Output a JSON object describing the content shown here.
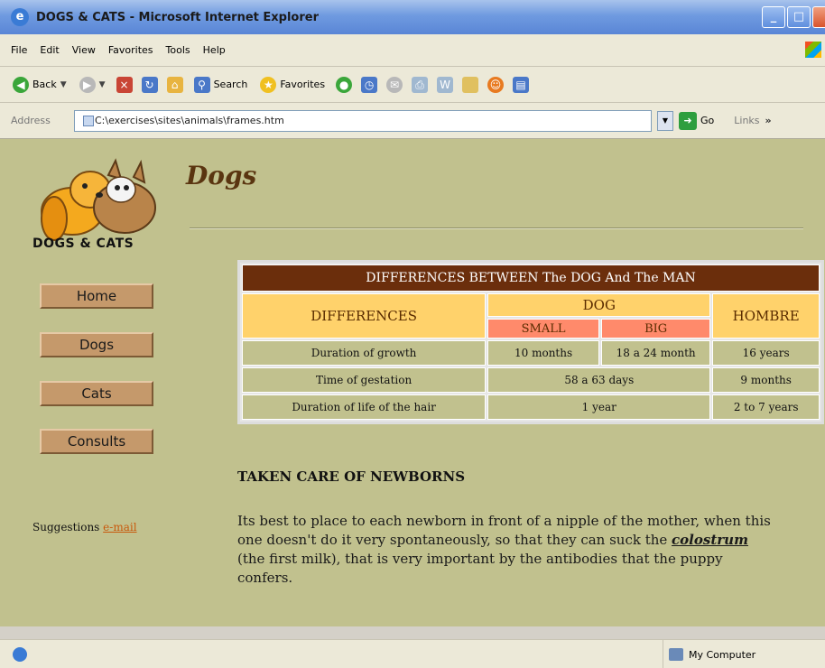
{
  "window": {
    "title": "DOGS & CATS - Microsoft Internet Explorer",
    "min_label": "_",
    "max_label": "□"
  },
  "menu": {
    "items": [
      "File",
      "Edit",
      "View",
      "Favorites",
      "Tools",
      "Help"
    ]
  },
  "toolbar": {
    "back_label": "Back",
    "search_label": "Search",
    "favorites_label": "Favorites"
  },
  "address": {
    "label": "Address",
    "value": "C:\\exercises\\sites\\animals\\frames.htm",
    "go_label": "Go",
    "links_label": "Links"
  },
  "sidebar": {
    "logo_text": "DOGS & CATS",
    "nav": [
      "Home",
      "Dogs",
      "Cats",
      "Consults"
    ],
    "suggestions_label": "Suggestions",
    "suggestions_link": "e-mail"
  },
  "main": {
    "title": "Dogs",
    "table": {
      "caption": "DIFFERENCES BETWEEN The DOG And The MAN",
      "col_differences": "DIFFERENCES",
      "col_dog": "DOG",
      "col_small": "SMALL",
      "col_big": "BIG",
      "col_hombre": "HOMBRE",
      "rows": [
        {
          "label": "Duration of growth",
          "small": "10 months",
          "big": "18 a 24 month",
          "hombre": "16 years"
        },
        {
          "label": "Time of gestation",
          "dog": "58 a 63 days",
          "hombre": "9 months"
        },
        {
          "label": "Duration of life of the hair",
          "dog": "1 year",
          "hombre": "2 to 7 years"
        }
      ]
    },
    "section_heading": "TAKEN CARE OF NEWBORNS",
    "paragraph_before": "Its best to place to each newborn in front of a nipple of the mother, when this one doesn't do it very spontaneously, so that they can suck the ",
    "paragraph_em": "colostrum",
    "paragraph_after": " (the first milk), that is very important by the antibodies that the puppy confers."
  },
  "status": {
    "zone_label": "My Computer"
  },
  "colors": {
    "page_bg": "#c1c18e",
    "table_caption_bg": "#6b2e0c",
    "table_header_bg": "#ffd26b",
    "table_sub_bg": "#ff8a6b",
    "nav_button_bg": "#c5996b",
    "title_color": "#5a3510"
  }
}
